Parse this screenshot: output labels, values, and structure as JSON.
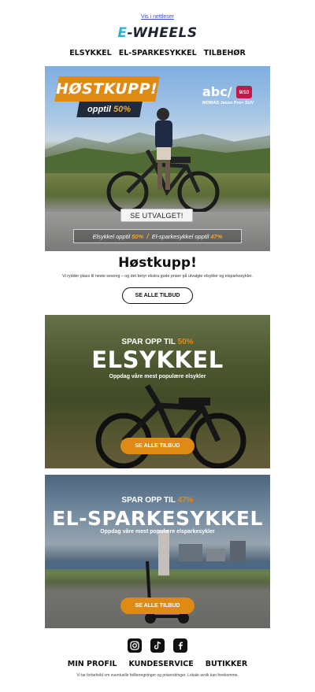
{
  "header": {
    "view_online": "Vis i nettleser",
    "logo_prefix": "E",
    "logo_rest": "-WHEELS"
  },
  "nav": [
    "ELSYKKEL",
    "EL-SPARKESYKKEL",
    "TILBEHØR"
  ],
  "hero": {
    "badge_title": "HØSTKUPP!",
    "badge_sub_prefix": "opptil ",
    "badge_sub_value": "50%",
    "brand": "abc/",
    "brand_number": "9/10",
    "brand_model": "MOMAS Jason Pro+ SUV",
    "cta": "SE UTVALGET!",
    "strip_left_label": "Elsykkel opptil ",
    "strip_left_value": "50%",
    "strip_separator": "/",
    "strip_right_label": "El-sparkesykkel opptil ",
    "strip_right_value": "47%"
  },
  "section": {
    "title": "Høstkupp!",
    "description": "Vi rydder plass til neste sesong – og det betyr ekstra gode priser på utvalgte elsykler og elsparkesykler.",
    "button": "SE ALLE TILBUD"
  },
  "cards": [
    {
      "kicker_prefix": "SPAR OPP TIL ",
      "kicker_value": "50%",
      "headline": "ELSYKKEL",
      "sub": "Oppdag våre mest populære elsykler",
      "button": "SE ALLE TILBUD"
    },
    {
      "kicker_prefix": "SPAR OPP TIL ",
      "kicker_value": "47%",
      "headline": "EL-SPARKESYKKEL",
      "sub": "Oppdag våre mest populære elsparkesykler",
      "button": "SE ALLE TILBUD"
    }
  ],
  "footer": {
    "socials": [
      "instagram-icon",
      "tiktok-icon",
      "facebook-icon"
    ],
    "nav": [
      "MIN PROFIL",
      "KUNDESERVICE",
      "BUTIKKER"
    ],
    "disclaimer": "Vi tar forbehold om eventuelle feilberegninger og prisendringer. Lokale avvik kan forekomme."
  },
  "colors": {
    "accent": "#e08a16",
    "logo_accent": "#2fb3ca",
    "brand_badge": "#c2184a"
  }
}
